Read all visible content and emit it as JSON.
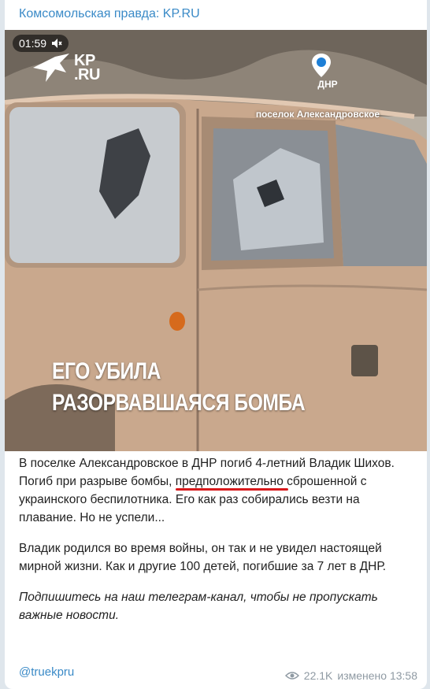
{
  "channel": {
    "name": "Комсомольская правда: KP.RU"
  },
  "video": {
    "duration": "01:59",
    "mute_icon": "muted-speaker-icon",
    "logo_kp": "KP",
    "logo_ru": ".RU",
    "pin_label": "ДНР",
    "location": "поселок Александровское",
    "headline_line1": "ЕГО УБИЛА",
    "headline_line2": "РАЗОРВАВШАЯСЯ БОМБА"
  },
  "post": {
    "p1_a": "В поселке Александровское в ДНР погиб 4-летний Владик Шихов. Погиб при разрыве бомбы, ",
    "p1_highlight": "предположительно",
    "p1_b": " сброшенной с украинского беспилотника. Его как раз собирались везти на плавание. Но не успели...",
    "p2": "Владик родился во время войны, он так и не увидел настоящей мирной жизни. Как и другие 100 детей, погибшие за 7 лет в ДНР.",
    "p3": "Подпишитесь на наш телеграм-канал, чтобы не пропускать важные новости.",
    "highlight_color": "#d8191c"
  },
  "footer": {
    "signature": "@truekpru",
    "views": "22.1K",
    "edited": "изменено 13:58",
    "eye_icon": "eye-icon"
  }
}
